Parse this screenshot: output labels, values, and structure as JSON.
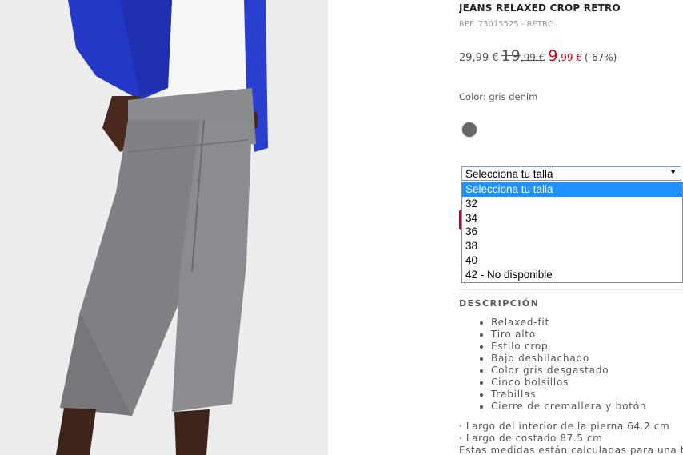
{
  "product": {
    "title": "JEANS RELAXED CROP RETRO",
    "ref": "REF. 73015525 - RETRO"
  },
  "price": {
    "original": "29,99 €",
    "previous_int": "19",
    "previous_dec": ",99 €",
    "current_int": "9",
    "current_dec": ",99 €",
    "discount": "(-67%)",
    "accent_color": "#d0021b"
  },
  "color": {
    "label": "Color: gris denim",
    "swatch_hex": "#66676b"
  },
  "size_select": {
    "selected": "Selecciona tu talla",
    "arrow_icon": "triangle-down",
    "options": [
      "Selecciona tu talla",
      "32",
      "34",
      "36",
      "38",
      "40",
      "42 - No disponible"
    ]
  },
  "description": {
    "title": "DESCRIPCIÓN",
    "items": [
      "Relaxed-fit",
      "Tiro alto",
      "Estilo crop",
      "Bajo deshilachado",
      "Color gris desgastado",
      "Cinco bolsillos",
      "Trabillas",
      "Cierre de cremallera y botón"
    ],
    "measures": [
      "· Largo del interior de la pierna 64.2 cm",
      "· Largo de costado 87.5 cm",
      "Estas medidas están calculadas para una ta"
    ]
  }
}
